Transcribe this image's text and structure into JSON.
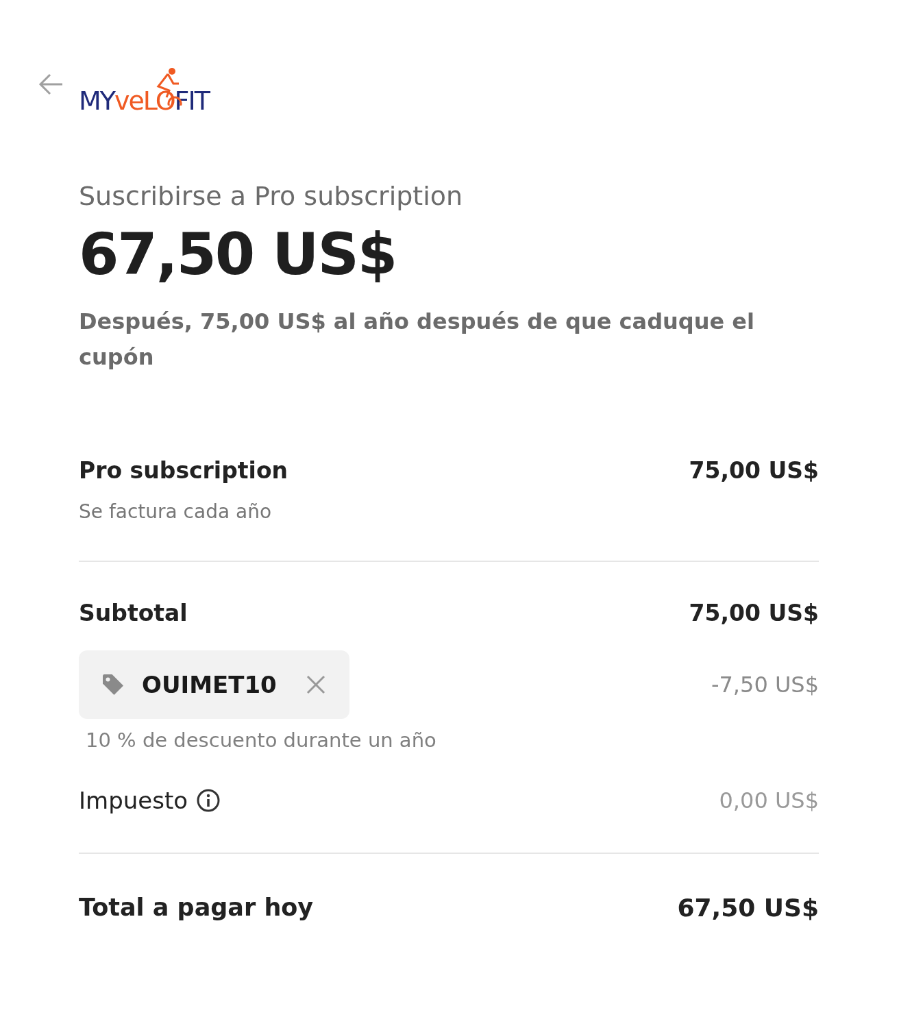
{
  "logo": {
    "parts": [
      {
        "text": "MY",
        "color": "#1f2a7a"
      },
      {
        "text": "veLO",
        "color": "#f05a22"
      },
      {
        "text": "FIT",
        "color": "#1f2a7a"
      }
    ]
  },
  "heading": "Suscribirse a Pro subscription",
  "price": "67,50 US$",
  "price_note": "Después, 75,00 US$ al año después de que caduque el cupón",
  "item": {
    "name": "Pro subscription",
    "billing": "Se factura cada año",
    "amount": "75,00 US$"
  },
  "subtotal": {
    "label": "Subtotal",
    "amount": "75,00 US$"
  },
  "coupon": {
    "code": "OUIMET10",
    "description": "10 % de descuento durante un año",
    "amount": "-7,50 US$"
  },
  "tax": {
    "label": "Impuesto",
    "amount": "0,00 US$"
  },
  "total": {
    "label": "Total a pagar hoy",
    "amount": "67,50 US$"
  }
}
